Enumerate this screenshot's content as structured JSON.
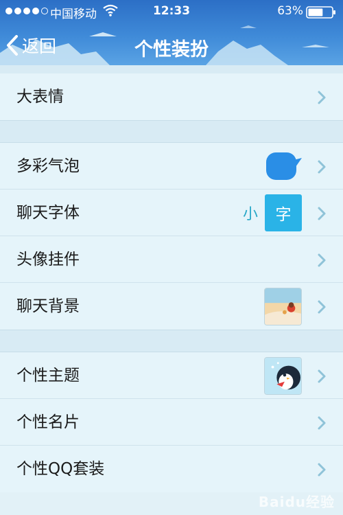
{
  "status_bar": {
    "carrier": "中国移动",
    "time": "12:33",
    "battery": "63%",
    "signal_bars_filled": 4,
    "signal_bars_total": 5,
    "battery_level": 0.63
  },
  "nav": {
    "back_label": "返回",
    "title": "个性装扮"
  },
  "groups": [
    {
      "items": [
        {
          "label": "大表情"
        }
      ]
    },
    {
      "items": [
        {
          "label": "多彩气泡",
          "accessory": "bubble"
        },
        {
          "label": "聊天字体",
          "accessory": "font"
        },
        {
          "label": "头像挂件"
        },
        {
          "label": "聊天背景",
          "accessory": "background-thumbnail"
        }
      ]
    },
    {
      "items": [
        {
          "label": "个性主题",
          "accessory": "theme-thumbnail"
        },
        {
          "label": "个性名片"
        },
        {
          "label": "个性QQ套装"
        }
      ]
    }
  ],
  "font_preview": {
    "small": "小",
    "box": "字"
  },
  "watermark": "Baidu经验",
  "colors": {
    "nav_bar": "#3f8ad8",
    "background": "#e2f1f7",
    "bubble": "#2a8ee6",
    "font_box": "#2ab3e7",
    "chevron": "#8fc3d8"
  }
}
